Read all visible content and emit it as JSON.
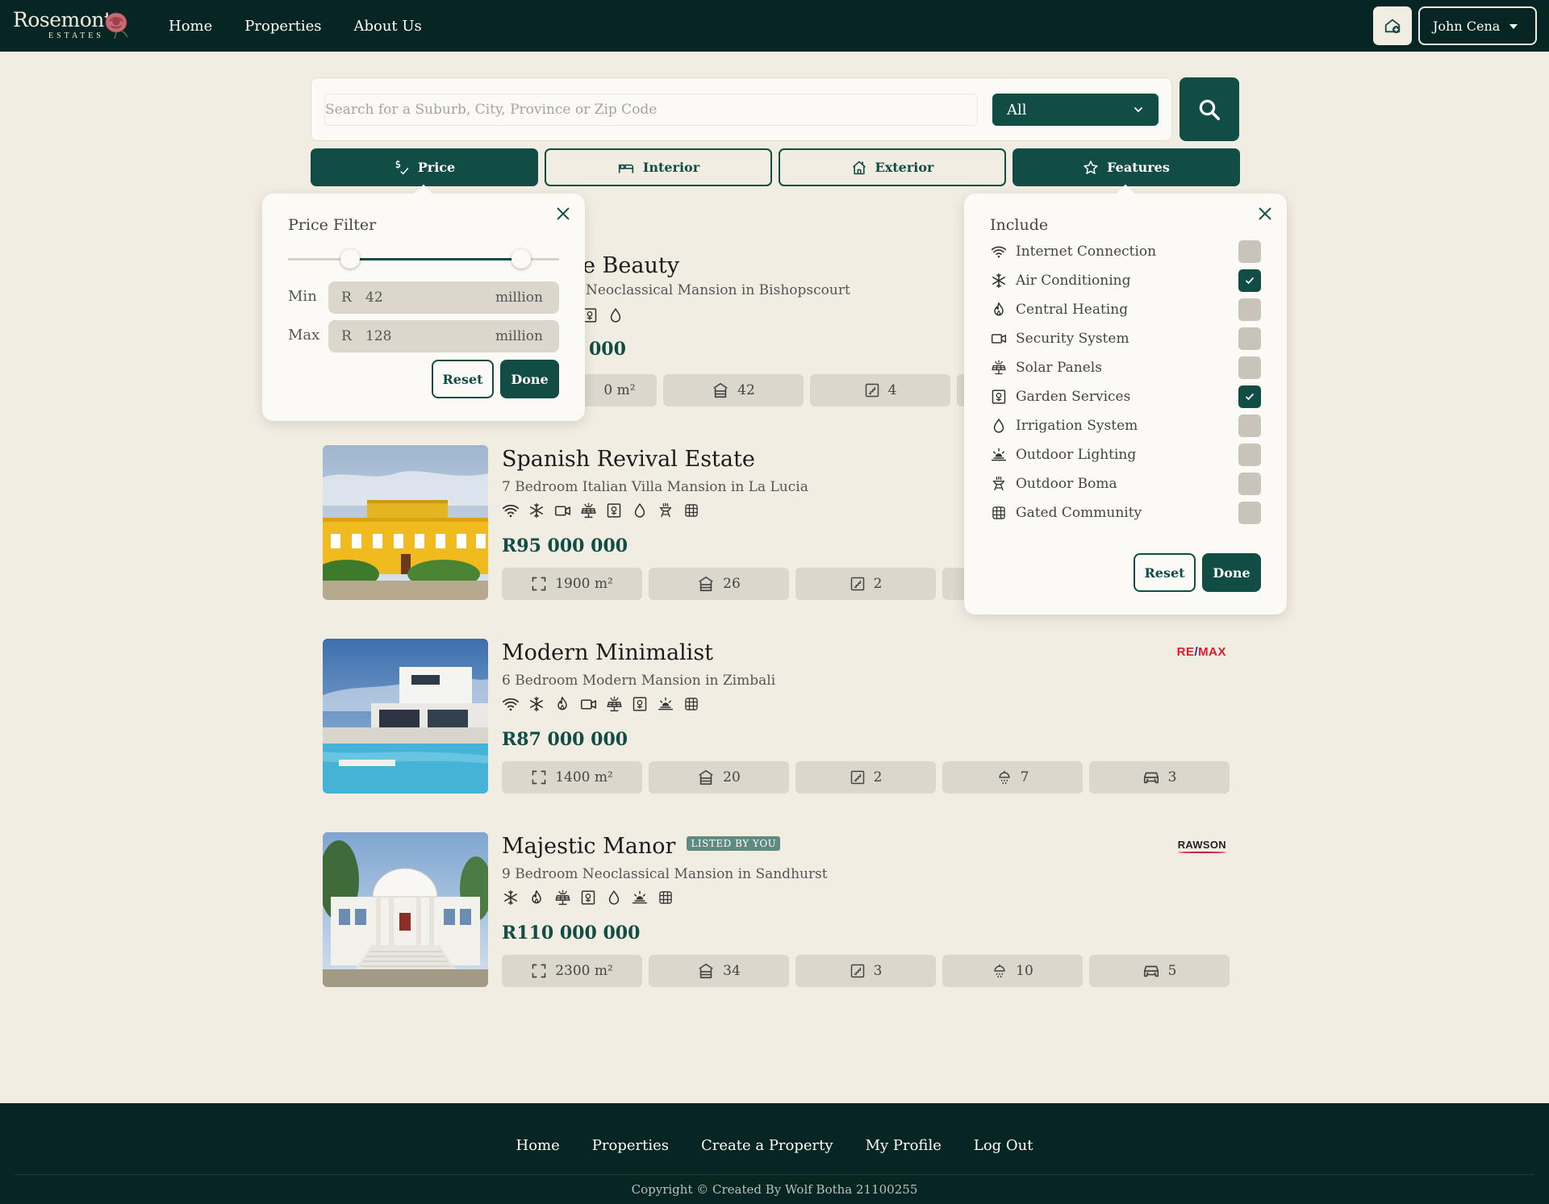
{
  "brand": {
    "name": "Rosemont",
    "tagline": "ESTATES"
  },
  "nav": {
    "links": [
      "Home",
      "Properties",
      "About Us"
    ]
  },
  "user": {
    "name": "John Cena"
  },
  "search": {
    "placeholder": "Search for a Suburb, City, Province or Zip Code",
    "value": "",
    "type_selected": "All"
  },
  "filter_tabs": [
    {
      "label": "Price",
      "icon": "price-icon",
      "active": true
    },
    {
      "label": "Interior",
      "icon": "bed-icon",
      "active": false
    },
    {
      "label": "Exterior",
      "icon": "house-icon",
      "active": false
    },
    {
      "label": "Features",
      "icon": "star-icon",
      "active": true
    }
  ],
  "price_filter": {
    "title": "Price Filter",
    "min_label": "Min",
    "max_label": "Max",
    "currency": "R",
    "min": "42",
    "max": "128",
    "unit": "million",
    "range_min_fraction": 0.23,
    "range_max_fraction": 0.86,
    "reset_label": "Reset",
    "done_label": "Done"
  },
  "include_filter": {
    "title": "Include",
    "items": [
      {
        "label": "Internet Connection",
        "icon": "wifi-icon",
        "checked": false
      },
      {
        "label": "Air Conditioning",
        "icon": "snowflake-icon",
        "checked": true
      },
      {
        "label": "Central Heating",
        "icon": "flame-icon",
        "checked": false
      },
      {
        "label": "Security System",
        "icon": "camera-icon",
        "checked": false
      },
      {
        "label": "Solar Panels",
        "icon": "solar-icon",
        "checked": false
      },
      {
        "label": "Garden Services",
        "icon": "garden-icon",
        "checked": true
      },
      {
        "label": "Irrigation System",
        "icon": "droplet-icon",
        "checked": false
      },
      {
        "label": "Outdoor Lighting",
        "icon": "sunrise-icon",
        "checked": false
      },
      {
        "label": "Outdoor Boma",
        "icon": "fire-pit-icon",
        "checked": false
      },
      {
        "label": "Gated Community",
        "icon": "gate-icon",
        "checked": false
      }
    ],
    "reset_label": "Reset",
    "done_label": "Done"
  },
  "listings": [
    {
      "title": "e Beauty",
      "subtitle": "Neoclassical Mansion in Bishopscourt",
      "price": "000",
      "stats": {
        "area": "0 m²",
        "rooms": "42",
        "baths": "4"
      }
    },
    {
      "title": "Spanish Revival Estate",
      "subtitle": "7 Bedroom Italian Villa Mansion in La Lucia",
      "price": "R95 000 000",
      "stats": {
        "area": "1900 m²",
        "rooms": "26",
        "baths": "2"
      }
    },
    {
      "title": "Modern Minimalist",
      "subtitle": "6 Bedroom Modern Mansion in Zimbali",
      "price": "R87 000 000",
      "agency": "RE/MAX",
      "stats": {
        "area": "1400 m²",
        "rooms": "20",
        "baths": "2",
        "showers": "7",
        "garages": "3"
      }
    },
    {
      "title": "Majestic Manor",
      "badge": "LISTED BY YOU",
      "subtitle": "9 Bedroom Neoclassical Mansion in Sandhurst",
      "price": "R110 000 000",
      "agency": "RAWSON",
      "stats": {
        "area": "2300 m²",
        "rooms": "34",
        "baths": "3",
        "showers": "10",
        "garages": "5"
      }
    }
  ],
  "footer": {
    "links": [
      "Home",
      "Properties",
      "Create a Property",
      "My Profile",
      "Log Out"
    ],
    "copyright": "Copyright © Created By Wolf Botha 21100255"
  },
  "colors": {
    "primary": "#114c45",
    "navbar": "#072522",
    "background": "#f2ede2",
    "remax_red": "#dc1c2e",
    "remax_blue": "#003da5"
  }
}
